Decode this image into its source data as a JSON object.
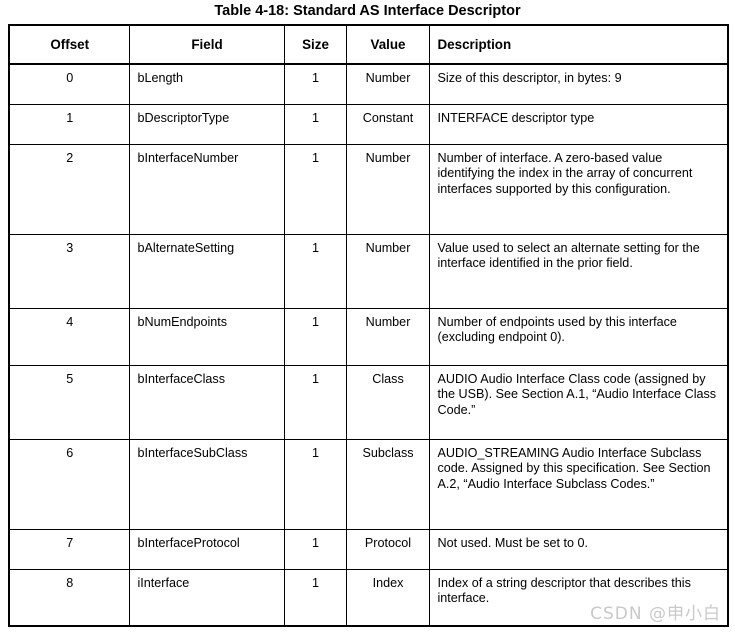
{
  "document": {
    "title": "Table 4-18: Standard AS Interface Descriptor",
    "watermark": "CSDN @申小白"
  },
  "table": {
    "headers": {
      "offset": "Offset",
      "field": "Field",
      "size": "Size",
      "value": "Value",
      "description": "Description"
    },
    "rows": [
      {
        "offset": "0",
        "field": "bLength",
        "size": "1",
        "value": "Number",
        "description": "Size of this descriptor, in bytes: 9"
      },
      {
        "offset": "1",
        "field": "bDescriptorType",
        "size": "1",
        "value": "Constant",
        "description": "INTERFACE descriptor type"
      },
      {
        "offset": "2",
        "field": "bInterfaceNumber",
        "size": "1",
        "value": "Number",
        "description": "Number of interface. A zero-based value identifying the index in the array of concurrent interfaces supported by this configuration."
      },
      {
        "offset": "3",
        "field": "bAlternateSetting",
        "size": "1",
        "value": "Number",
        "description": "Value used to select an alternate setting for the interface identified in the prior field."
      },
      {
        "offset": "4",
        "field": "bNumEndpoints",
        "size": "1",
        "value": "Number",
        "description": "Number of endpoints used by this interface (excluding endpoint 0)."
      },
      {
        "offset": "5",
        "field": "bInterfaceClass",
        "size": "1",
        "value": "Class",
        "description": "AUDIO Audio Interface Class code (assigned by the USB). See Section A.1, “Audio Interface Class Code.”"
      },
      {
        "offset": "6",
        "field": "bInterfaceSubClass",
        "size": "1",
        "value": "Subclass",
        "description": "AUDIO_STREAMING Audio Interface Subclass code. Assigned by this specification. See Section A.2, “Audio Interface Subclass Codes.”"
      },
      {
        "offset": "7",
        "field": "bInterfaceProtocol",
        "size": "1",
        "value": "Protocol",
        "description": "Not used. Must be set to 0."
      },
      {
        "offset": "8",
        "field": "iInterface",
        "size": "1",
        "value": "Index",
        "description": "Index of a string descriptor that describes this interface."
      }
    ]
  }
}
